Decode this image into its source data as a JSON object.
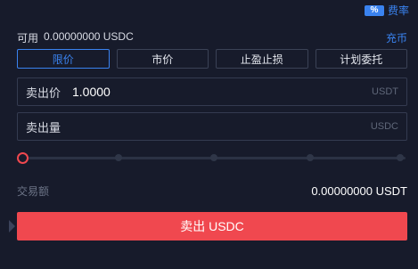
{
  "fee": {
    "badge": "%",
    "label": "费率"
  },
  "available": {
    "label": "可用",
    "value": "0.00000000 USDC",
    "link": "充币"
  },
  "tabs": [
    {
      "label": "限价",
      "active": true
    },
    {
      "label": "市价",
      "active": false
    },
    {
      "label": "止盈止损",
      "active": false
    },
    {
      "label": "计划委托",
      "active": false
    }
  ],
  "price": {
    "label": "卖出价",
    "value": "1.0000",
    "unit": "USDT"
  },
  "quantity": {
    "label": "卖出量",
    "value": "",
    "unit": "USDC"
  },
  "slider": {
    "level_percent": 0,
    "steps": [
      0,
      25,
      50,
      75,
      100
    ]
  },
  "amount": {
    "label": "交易额",
    "value": "0.00000000 USDT"
  },
  "sell_button": {
    "label": "卖出 USDC"
  },
  "colors": {
    "accent": "#3a83f0",
    "sell": "#f0484f",
    "background": "#171b2b"
  }
}
